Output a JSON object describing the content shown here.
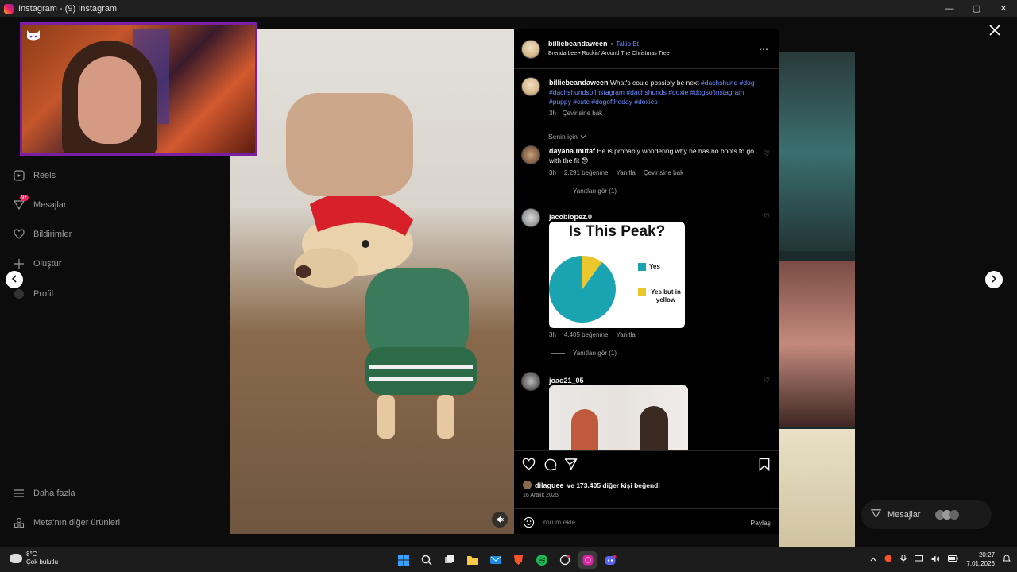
{
  "window": {
    "title": "Instagram - (9) Instagram",
    "controls": [
      "—",
      "▢",
      "✕"
    ]
  },
  "sidenav": {
    "items": [
      {
        "label": "Reels",
        "icon": "reels-icon"
      },
      {
        "label": "Mesajlar",
        "icon": "messenger-icon",
        "badge": "9+"
      },
      {
        "label": "Bildirimler",
        "icon": "heart-icon"
      },
      {
        "label": "Oluştur",
        "icon": "plus-icon"
      },
      {
        "label": "Profil",
        "icon": "profile-icon"
      }
    ],
    "bottom_items": [
      {
        "label": "Daha fazla",
        "icon": "menu-icon"
      },
      {
        "label": "Meta'nın diğer ürünleri",
        "icon": "grid-icon"
      }
    ]
  },
  "post": {
    "author": "billiebeandaween",
    "separator": "•",
    "follow_label": "Takip Et",
    "music": "Brenda Lee • Rockin' Around The Christmas Tree",
    "caption_user": "billiebeandaween",
    "caption_text": "What's could possibly be next",
    "hashtags": "#dachshund #dog #dachshundsofinstagram #dachshunds #doxie #dogsofinstagram #puppy #cute #dogoftheday #doxies",
    "caption_time": "3h",
    "translate_label": "Çevirisine bak",
    "sort_label": "Senin için",
    "likes_user": "dilaguee",
    "likes_text": "ve 173.405 diğer kişi beğendi",
    "date": "16 Aralık 2025",
    "comment_placeholder": "Yorum ekle...",
    "share_label": "Paylaş"
  },
  "comments": [
    {
      "user": "dayana.mutaf",
      "text": "He is probably wondering why he has no boots to go with the fit 😳",
      "time": "3h",
      "likes": "2.291 beğenme",
      "reply": "Yanıtla",
      "translate": "Çevirisine bak",
      "replies": "Yanıtları gör (1)"
    },
    {
      "user": "jacoblopez.0",
      "time": "3h",
      "likes": "4.405 beğenme",
      "reply": "Yanıtla",
      "replies": "Yanıtları gör (1)"
    },
    {
      "user": "joao21_05"
    }
  ],
  "chart_data": {
    "type": "pie",
    "title": "Is This Peak?",
    "categories": [
      "Yes",
      "Yes but in yellow"
    ],
    "values": [
      90,
      10
    ],
    "colors": [
      "#1aa3b0",
      "#ecc72b"
    ]
  },
  "colors": {
    "accent": "#6a8cff",
    "webcam_border": "#7b1fa2",
    "badge": "#e0245e"
  },
  "overlay": {
    "messages_label": "Mesajlar"
  },
  "taskbar": {
    "temp": "8°C",
    "weather": "Çok bulutlu",
    "time": "20:27",
    "date": "7.01.2026"
  }
}
